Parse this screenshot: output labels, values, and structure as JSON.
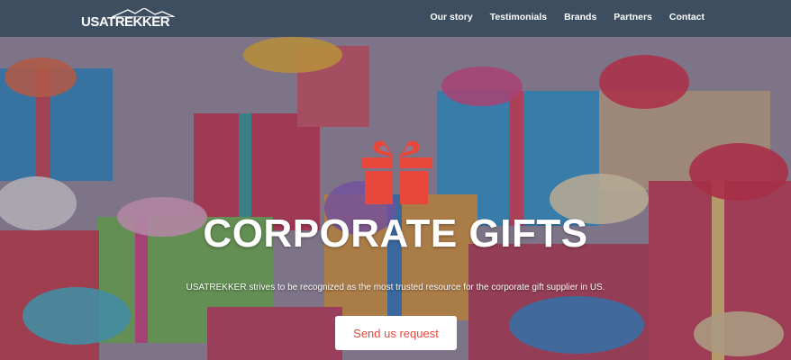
{
  "brand": {
    "logo_text": "USATREKKER",
    "logo_icon": "mountain-icon"
  },
  "nav": {
    "items": [
      {
        "label": "Our story"
      },
      {
        "label": "Testimonials"
      },
      {
        "label": "Brands"
      },
      {
        "label": "Partners"
      },
      {
        "label": "Contact"
      }
    ]
  },
  "hero": {
    "icon": "gift-icon",
    "title": "CORPORATE GIFTS",
    "subtitle": "USATREKKER strives to be recognized as the most trusted resource for the corporate gift supplier in US.",
    "cta_label": "Send us request"
  },
  "colors": {
    "navbar": "#3d4e60",
    "accent": "#e8473c",
    "text_light": "#ffffff"
  }
}
